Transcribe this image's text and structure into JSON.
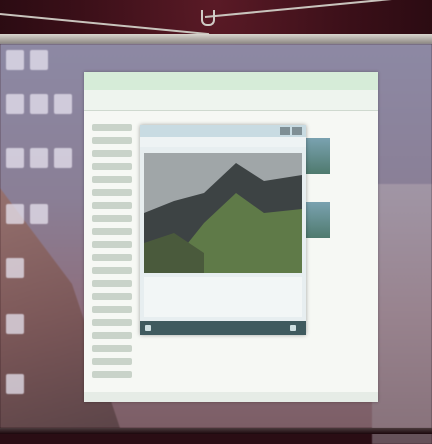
{
  "scene": {
    "subject": "projection-screen",
    "colors": {
      "wall": "#3a0f18",
      "screen_tint": "#8a7f96",
      "explorer_header": "#d6ecd8",
      "viewer_title": "#c8dbe2",
      "taskbar": "#3f5a5e",
      "mountain_dark": "#3d4344",
      "mountain_green": "#5f7a48",
      "sky": "#a0a6a8"
    }
  }
}
